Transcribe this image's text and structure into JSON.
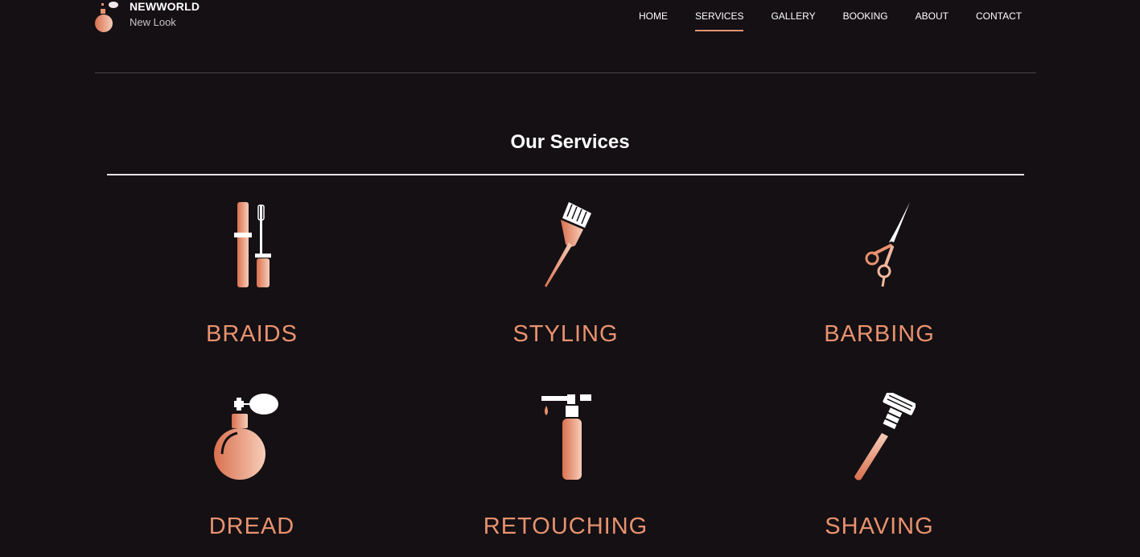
{
  "brand": {
    "name": "NEWWORLD",
    "tagline": "New Look"
  },
  "nav": {
    "items": [
      {
        "label": "HOME"
      },
      {
        "label": "SERVICES",
        "active": true
      },
      {
        "label": "GALLERY"
      },
      {
        "label": "BOOKING"
      },
      {
        "label": "ABOUT"
      },
      {
        "label": "CONTACT"
      }
    ]
  },
  "section": {
    "title": "Our Services"
  },
  "services": [
    {
      "label": "BRAIDS",
      "icon": "mascara-icon"
    },
    {
      "label": "STYLING",
      "icon": "hair-dye-brush-icon"
    },
    {
      "label": "BARBING",
      "icon": "scissors-icon"
    },
    {
      "label": "DREAD",
      "icon": "perfume-bottle-icon"
    },
    {
      "label": "RETOUCHING",
      "icon": "spray-bottle-icon"
    },
    {
      "label": "SHAVING",
      "icon": "razor-icon"
    }
  ],
  "colors": {
    "background": "#141013",
    "accent": "#e8926f",
    "accent_light": "#f5c4b0",
    "text": "#ffffff"
  }
}
